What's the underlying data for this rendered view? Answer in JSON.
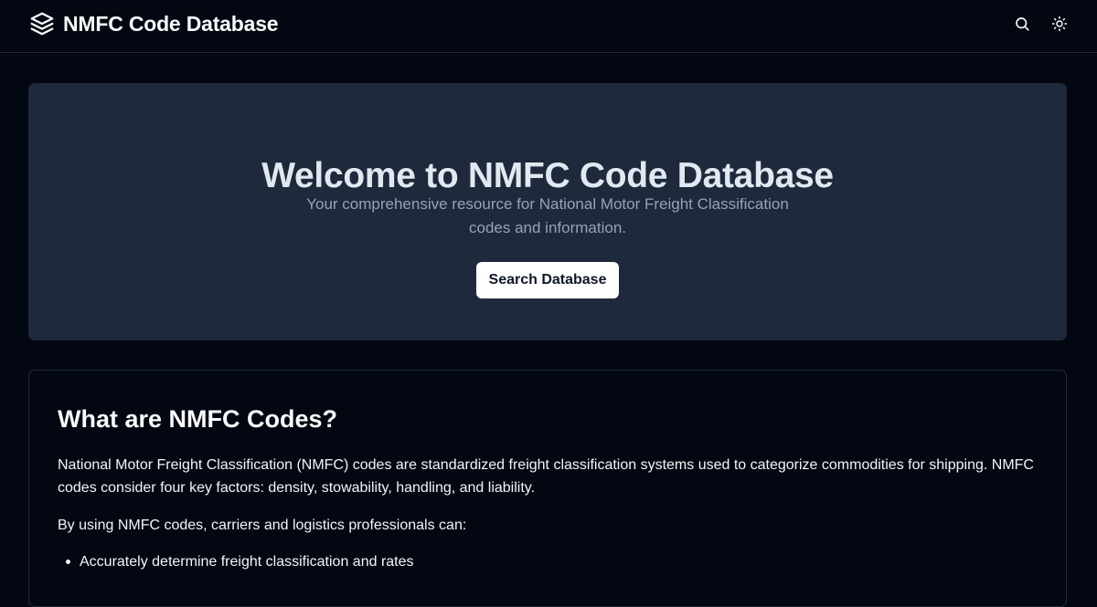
{
  "header": {
    "title": "NMFC Code Database",
    "logo_icon": "layers-icon",
    "search_icon": "search-icon",
    "theme_icon": "sun-icon"
  },
  "hero": {
    "title": "Welcome to NMFC Code Database",
    "subtitle": "Your comprehensive resource for National Motor Freight Classification codes and information.",
    "button_label": "Search Database"
  },
  "info": {
    "heading": "What are NMFC Codes?",
    "paragraph1": "National Motor Freight Classification (NMFC) codes are standardized freight classification systems used to categorize commodities for shipping. NMFC codes consider four key factors: density, stowability, handling, and liability.",
    "paragraph2": "By using NMFC codes, carriers and logistics professionals can:",
    "bullets": [
      "Accurately determine freight classification and rates"
    ]
  },
  "colors": {
    "background": "#030712",
    "hero_background": "#1e293b",
    "muted_text": "#94a3b8",
    "button_background": "#ffffff"
  }
}
